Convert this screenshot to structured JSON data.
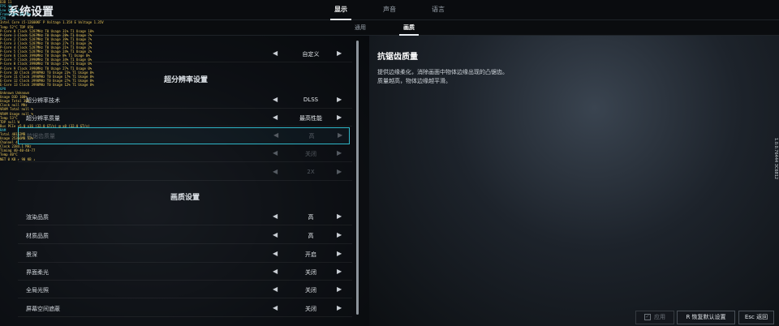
{
  "header": {
    "title": "系统设置",
    "tabs": [
      {
        "label": "显示",
        "active": true
      },
      {
        "label": "声音",
        "active": false
      },
      {
        "label": "语言",
        "active": false
      }
    ],
    "subtabs": [
      {
        "label": "通用",
        "active": false
      },
      {
        "label": "画质",
        "active": true
      }
    ]
  },
  "sections": {
    "upscale": "超分辨率设置",
    "quality": "画质设置"
  },
  "rows": [
    {
      "label": "",
      "value": "自定义",
      "enabled": true
    },
    {
      "label": "超分辨率技术",
      "value": "DLSS",
      "enabled": true
    },
    {
      "label": "超分辨率质量",
      "value": "最高性能",
      "enabled": true
    },
    {
      "label": "抗锯齿质量",
      "value": "高",
      "enabled": false,
      "highlight": true
    },
    {
      "label": "",
      "value": "关闭",
      "enabled": false
    },
    {
      "label": "",
      "value": "2X",
      "enabled": false
    },
    {
      "label": "渲染品质",
      "value": "高",
      "enabled": true
    },
    {
      "label": "材质品质",
      "value": "高",
      "enabled": true
    },
    {
      "label": "景深",
      "value": "开启",
      "enabled": true
    },
    {
      "label": "界面柔光",
      "value": "关闭",
      "enabled": true
    },
    {
      "label": "全局光照",
      "value": "关闭",
      "enabled": true
    },
    {
      "label": "屏幕空间遮蔽",
      "value": "关闭",
      "enabled": true
    }
  ],
  "details": {
    "title": "抗锯齿质量",
    "line1": "提供边缘柔化，消除画面中物体边缘出现的凸锯齿。",
    "line2": "质量越高，物体边缘越平滑。"
  },
  "sidebar_text": "1.0.0.76444  3C6812",
  "buttons": {
    "apply": "应用",
    "reset": "R 恢复默认设置",
    "back": "Esc 返回"
  },
  "osd": {
    "lines": [
      "D3D 11",
      "FPS 44",
      "Low 0.1%    1",
      "Frametime   16.7ms",
      "CPU",
      "Intel Core i5-12600KF   P Voltage 1.35V   E Voltage 1.35V",
      "Temp  52°C    TDP  65W",
      "P-Core 0   Clock 5287MHz   T0 Usage 31%   T1 Usage 10%",
      "P-Core 1   Clock 5287MHz   T0 Usage 28%   T1 Usage 7%",
      "P-Core 2   Clock 5287MHz   T0 Usage 39%   T1 Usage 7%",
      "P-Core 3   Clock 5287MHz   T0 Usage 27%   T1 Usage 3%",
      "P-Core 4   Clock 5287MHz   T0 Usage 21%   T1 Usage 2%",
      "P-Core 5   Clock 5287MHz   T0 Usage 24%   T1 Usage 2%",
      "P-Core 6   Clock 3990MHz   T0 Usage 8%    T1 Usage 0%",
      "P-Core 7   Clock 3990MHz   T0 Usage 34%   T1 Usage 0%",
      "P-Core 8   Clock 3990MHz   T0 Usage 27%   T1 Usage 0%",
      "P-Core 9   Clock 3990MHz   T0 Usage 27%   T1 Usage 0%",
      "P-Core 10  Clock 3990MHz   T0 Usage 23%   T1 Usage 0%",
      "P-Core 11  Clock 3990MHz   T0 Usage 17%   T1 Usage 0%",
      "E-Core 12  Clock 3990MHz   T0 Usage 27%   T1 Usage 0%",
      "E-Core 13  Clock 3990MHz   T0 Usage 12%   T1 Usage 0%",
      "GPU",
      "Unknown Unknown",
      "Usage D3D   100%",
      "Usage Total   38%",
      "Clock   null MHz",
      "VRAM Total   null %",
      "VRAM Usage   null %",
      "Temp   53°C",
      "TDP   null W",
      "Bus   PCIe v5.0 x16 (32.0 GT/s) @ x8 (32.0 GT/s)",
      "RAM",
      "Total   48152MB",
      "Usage   25366MB   52%",
      "Channel   4",
      "Clock   2384.1 MHz",
      "Timing   40-40-40-77",
      "Temp   40°C",
      "NET   0 KB  ↑   90 KB  ↓"
    ]
  }
}
